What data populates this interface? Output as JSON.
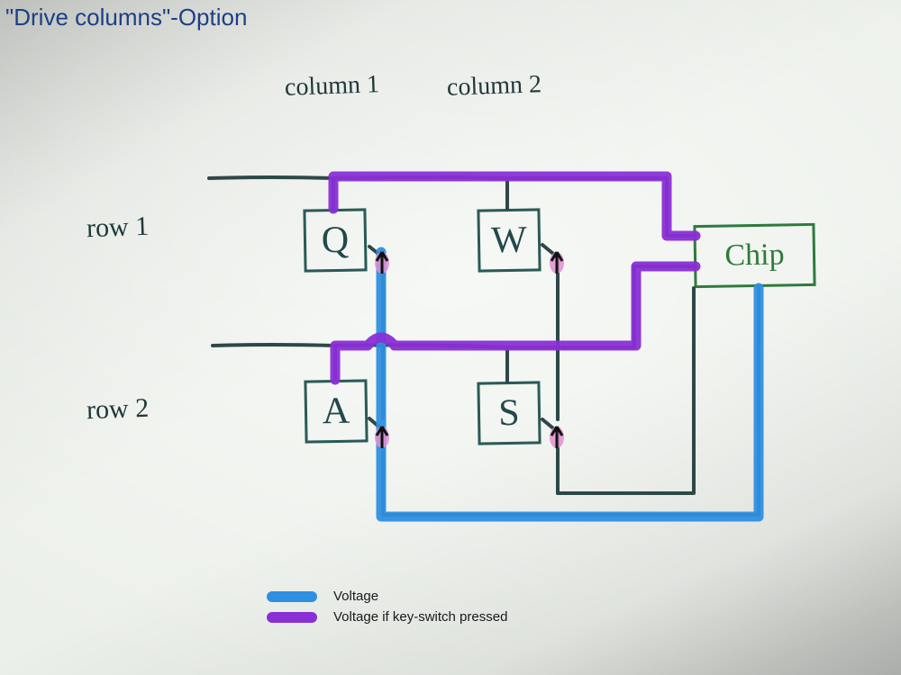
{
  "title": "\"Drive columns\"-Option",
  "columns": {
    "c1": "column 1",
    "c2": "column 2"
  },
  "rows": {
    "r1": "row 1",
    "r2": "row 2"
  },
  "keys": {
    "q": "Q",
    "w": "W",
    "a": "A",
    "s": "S"
  },
  "chip": "Chip",
  "legend": {
    "voltage": "Voltage",
    "voltage_pressed": "Voltage if key-switch pressed"
  },
  "colors": {
    "pen_dark": "#2e4747",
    "pen_green": "#2e7a3e",
    "blue": "#2f8fe0",
    "purple": "#8a2fd6",
    "diode_pink": "#e08fd0",
    "title_blue": "#1d3f86"
  }
}
